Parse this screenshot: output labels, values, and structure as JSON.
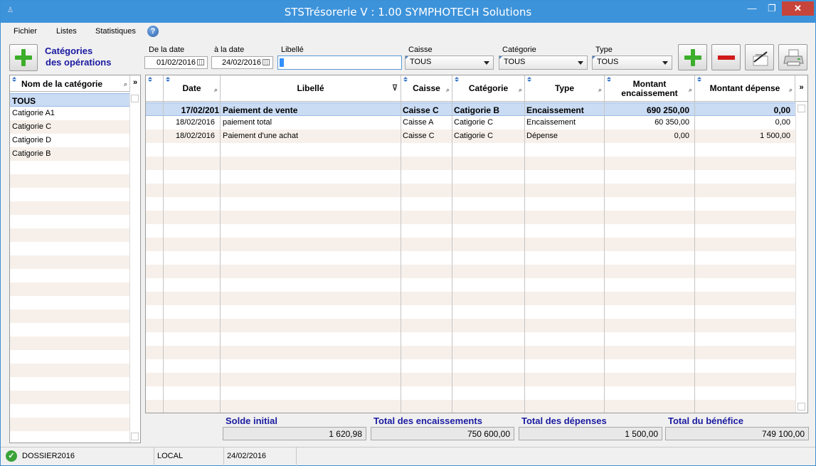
{
  "window": {
    "title": "STSTrésorerie V : 1.00  SYMPHOTECH Solutions",
    "minimize": "—",
    "maximize": "❐",
    "close": "✕"
  },
  "menu": {
    "items": [
      "Fichier",
      "Listes",
      "Statistiques"
    ],
    "help_icon": "?"
  },
  "toolbar": {
    "section_title_line1": "Catégories",
    "section_title_line2": "des opérations",
    "from_label": "De la date",
    "from_value": "01/02/2016",
    "to_label": "à la date",
    "to_value": "24/02/2016",
    "libelle_label": "Libellé",
    "libelle_value": "",
    "caisse_label": "Caisse",
    "caisse_value": "TOUS",
    "categorie_label": "Catégorie",
    "categorie_value": "TOUS",
    "type_label": "Type",
    "type_value": "TOUS",
    "icons": [
      "add-icon",
      "remove-icon",
      "edit-icon",
      "print-icon"
    ]
  },
  "left_panel": {
    "header": "Nom de la catégorie",
    "more": "»",
    "items": [
      "TOUS",
      "Catigorie A1",
      "Catigorie C",
      "Catigorie D",
      "Catigorie B"
    ]
  },
  "grid": {
    "more": "»",
    "columns": [
      "Date",
      "Libellé",
      "Caisse",
      "Catégorie",
      "Type",
      "Montant encaissement",
      "Montant dépense"
    ],
    "col_montant_enc_l1": "Montant",
    "col_montant_enc_l2": "encaissement",
    "rows": [
      {
        "date": "17/02/201",
        "libelle": "Paiement de vente",
        "caisse": "Caisse C",
        "categorie": "Catigorie B",
        "type": "Encaissement",
        "encaissement": "690 250,00",
        "depense": "0,00"
      },
      {
        "date": "18/02/2016",
        "libelle": "paiement total",
        "caisse": "Caisse A",
        "categorie": "Catigorie C",
        "type": "Encaissement",
        "encaissement": "60 350,00",
        "depense": "0,00"
      },
      {
        "date": "18/02/2016",
        "libelle": "Paiement d'une achat",
        "caisse": "Caisse C",
        "categorie": "Catigorie C",
        "type": "Dépense",
        "encaissement": "0,00",
        "depense": "1 500,00"
      }
    ]
  },
  "totals": {
    "solde_label": "Solde initial",
    "solde_value": "1 620,98",
    "enc_label": "Total des encaissements",
    "enc_value": "750 600,00",
    "dep_label": "Total des dépenses",
    "dep_value": "1 500,00",
    "benefice_label": "Total du bénéfice",
    "benefice_value": "749 100,00"
  },
  "status": {
    "dossier": "DOSSIER2016",
    "mode": "LOCAL",
    "date": "24/02/2016"
  },
  "colors": {
    "titlebar": "#3d93da",
    "accent_text": "#1a1aa0",
    "selected_row": "#cadcf4",
    "alt_row": "#f7f0ea"
  }
}
